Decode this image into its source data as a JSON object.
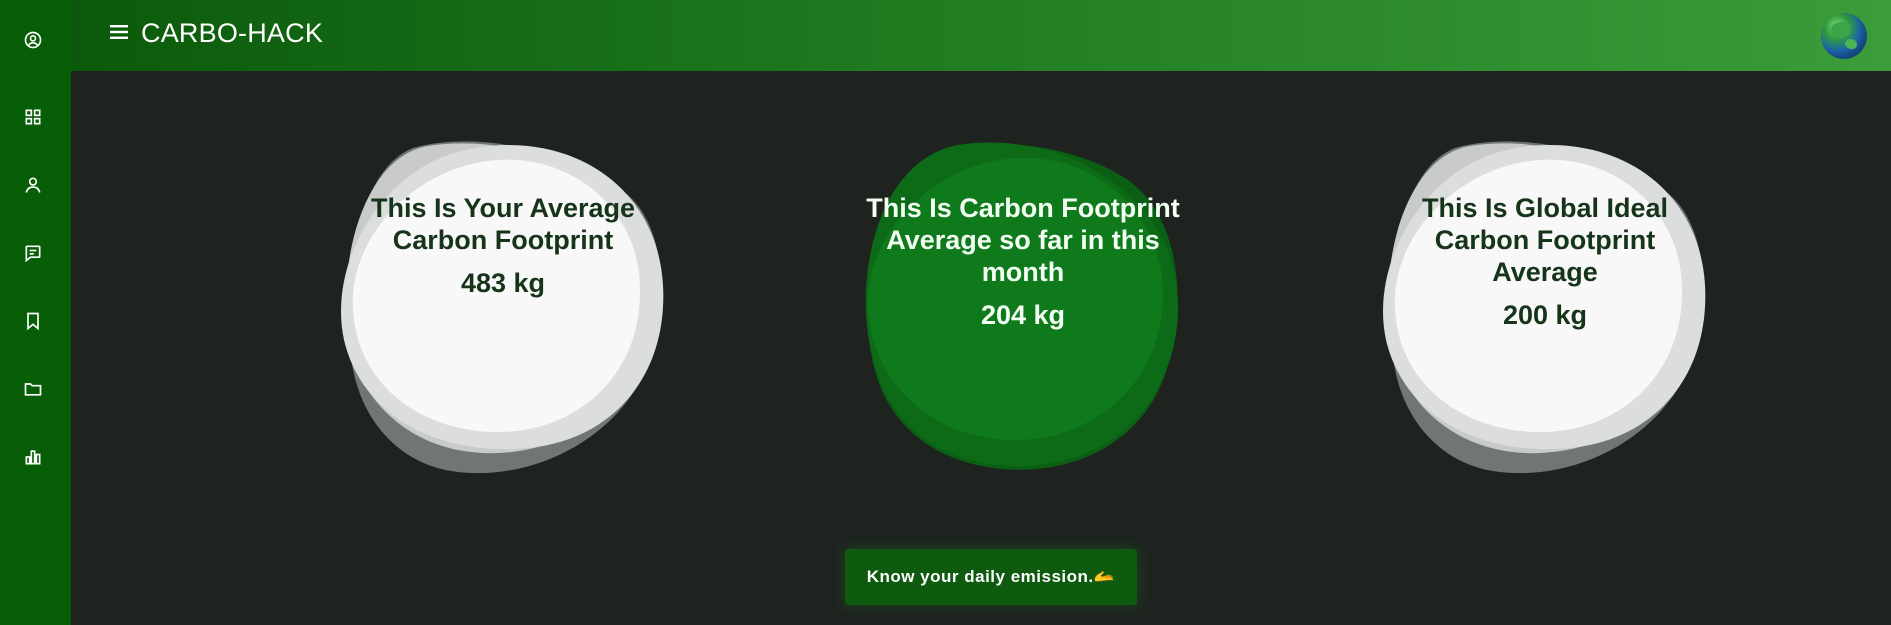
{
  "app": {
    "title": "CARBO-HACK"
  },
  "sidebar": {
    "items": [
      {
        "icon": "user-circle-icon"
      },
      {
        "icon": "dashboard-grid-icon"
      },
      {
        "icon": "profile-icon"
      },
      {
        "icon": "message-icon"
      },
      {
        "icon": "bookmark-icon"
      },
      {
        "icon": "folder-icon"
      },
      {
        "icon": "bar-chart-icon"
      }
    ]
  },
  "cards": [
    {
      "title": "This Is Your Average Carbon Footprint",
      "value": "483 kg",
      "style": "white"
    },
    {
      "title": "This Is Carbon Footprint Average so far in this month",
      "value": "204 kg",
      "style": "green"
    },
    {
      "title": "This Is Global Ideal Carbon Footprint Average",
      "value": "200 kg",
      "style": "white"
    }
  ],
  "cta": {
    "label": "Know your daily emission.🫴"
  },
  "colors": {
    "sidebar": "#075e07",
    "background": "#1e2320",
    "accent_green": "#0b7a1e",
    "cta": "#0e5a0e"
  }
}
